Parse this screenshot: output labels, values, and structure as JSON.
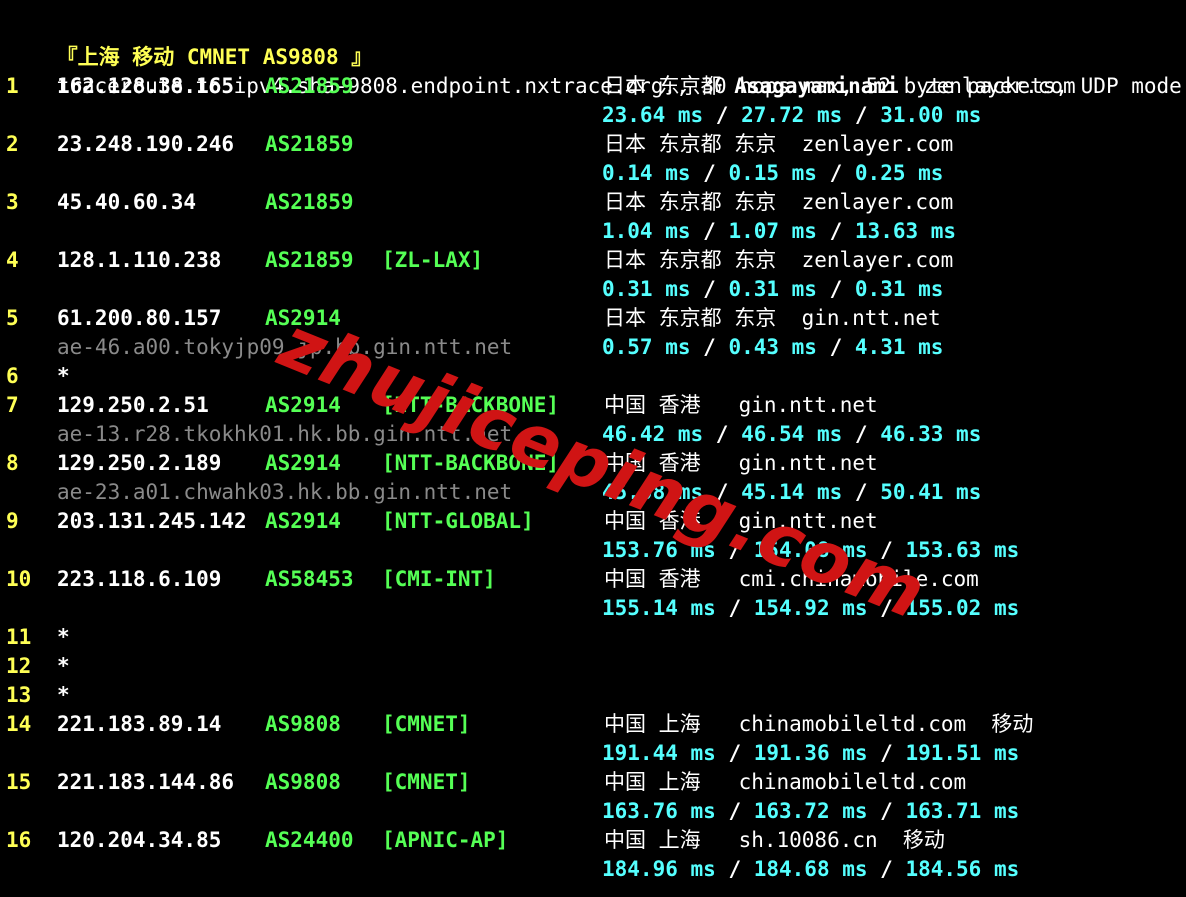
{
  "header": {
    "title": "『上海 移动 CMNET AS9808 』",
    "command": "traceroute to ipv4.sha-9808.endpoint.nxtrace.org., 30 hops max, 52 byte packets, UDP mode"
  },
  "hops": [
    {
      "n": "1",
      "ip": "162.128.38.165",
      "asn": "AS21859",
      "tag": "",
      "host": "",
      "loc": "日本 东京都 ",
      "loc_bold": "Asagayaminami",
      "loc_tail": "  zenlayer.com",
      "rtt": [
        "23.64 ms",
        "27.72 ms",
        "31.00 ms"
      ]
    },
    {
      "n": "2",
      "ip": "23.248.190.246",
      "asn": "AS21859",
      "tag": "",
      "host": "",
      "loc": "日本 东京都 东京  zenlayer.com",
      "loc_bold": "",
      "loc_tail": "",
      "rtt": [
        "0.14 ms",
        "0.15 ms",
        "0.25 ms"
      ]
    },
    {
      "n": "3",
      "ip": "45.40.60.34",
      "asn": "AS21859",
      "tag": "",
      "host": "",
      "loc": "日本 东京都 东京  zenlayer.com",
      "loc_bold": "",
      "loc_tail": "",
      "rtt": [
        "1.04 ms",
        "1.07 ms",
        "13.63 ms"
      ]
    },
    {
      "n": "4",
      "ip": "128.1.110.238",
      "asn": "AS21859",
      "tag": "[ZL-LAX]",
      "host": "",
      "loc": "日本 东京都 东京  zenlayer.com",
      "loc_bold": "",
      "loc_tail": "",
      "rtt": [
        "0.31 ms",
        "0.31 ms",
        "0.31 ms"
      ]
    },
    {
      "n": "5",
      "ip": "61.200.80.157",
      "asn": "AS2914",
      "tag": "",
      "host": "ae-46.a00.tokyjp09.jp.bb.gin.ntt.net",
      "loc": "日本 东京都 东京  gin.ntt.net",
      "loc_bold": "",
      "loc_tail": "",
      "rtt": [
        "0.57 ms",
        "0.43 ms",
        "4.31 ms"
      ]
    },
    {
      "n": "6",
      "star": "*"
    },
    {
      "n": "7",
      "ip": "129.250.2.51",
      "asn": "AS2914",
      "tag": "[NTT-BACKBONE]",
      "host": "ae-13.r28.tkokhk01.hk.bb.gin.ntt.net",
      "loc": "中国 香港   gin.ntt.net",
      "loc_bold": "",
      "loc_tail": "",
      "rtt": [
        "46.42 ms",
        "46.54 ms",
        "46.33 ms"
      ]
    },
    {
      "n": "8",
      "ip": "129.250.2.189",
      "asn": "AS2914",
      "tag": "[NTT-BACKBONE]",
      "host": "ae-23.a01.chwahk03.hk.bb.gin.ntt.net",
      "loc": "中国 香港   gin.ntt.net",
      "loc_bold": "",
      "loc_tail": "",
      "rtt": [
        "45.08 ms",
        "45.14 ms",
        "50.41 ms"
      ]
    },
    {
      "n": "9",
      "ip": "203.131.245.142",
      "asn": "AS2914",
      "tag": "[NTT-GLOBAL]",
      "host": "",
      "loc": "中国 香港   gin.ntt.net",
      "loc_bold": "",
      "loc_tail": "",
      "rtt": [
        "153.76 ms",
        "154.08 ms",
        "153.63 ms"
      ]
    },
    {
      "n": "10",
      "ip": "223.118.6.109",
      "asn": "AS58453",
      "tag": "[CMI-INT]",
      "host": "",
      "loc": "中国 香港   cmi.chinamobile.com",
      "loc_bold": "",
      "loc_tail": "",
      "rtt": [
        "155.14 ms",
        "154.92 ms",
        "155.02 ms"
      ]
    },
    {
      "n": "11",
      "star": "*"
    },
    {
      "n": "12",
      "star": "*"
    },
    {
      "n": "13",
      "star": "*"
    },
    {
      "n": "14",
      "ip": "221.183.89.14",
      "asn": "AS9808",
      "tag": "[CMNET]",
      "host": "",
      "loc": "中国 上海   chinamobileltd.com  移动",
      "loc_bold": "",
      "loc_tail": "",
      "rtt": [
        "191.44 ms",
        "191.36 ms",
        "191.51 ms"
      ]
    },
    {
      "n": "15",
      "ip": "221.183.144.86",
      "asn": "AS9808",
      "tag": "[CMNET]",
      "host": "",
      "loc": "中国 上海   chinamobileltd.com",
      "loc_bold": "",
      "loc_tail": "",
      "rtt": [
        "163.76 ms",
        "163.72 ms",
        "163.71 ms"
      ]
    },
    {
      "n": "16",
      "ip": "120.204.34.85",
      "asn": "AS24400",
      "tag": "[APNIC-AP]",
      "host": "",
      "loc": "中国 上海   sh.10086.cn  移动",
      "loc_bold": "",
      "loc_tail": "",
      "rtt": [
        "184.96 ms",
        "184.68 ms",
        "184.56 ms"
      ]
    }
  ],
  "rtt_separator": " / ",
  "watermark": "zhujiceping.com",
  "colors": {
    "background": "#000000",
    "hop_number": "#ffff55",
    "asn": "#55ff55",
    "rtt": "#55ffff",
    "hostname": "#8a8a8a",
    "watermark": "#d01414"
  }
}
